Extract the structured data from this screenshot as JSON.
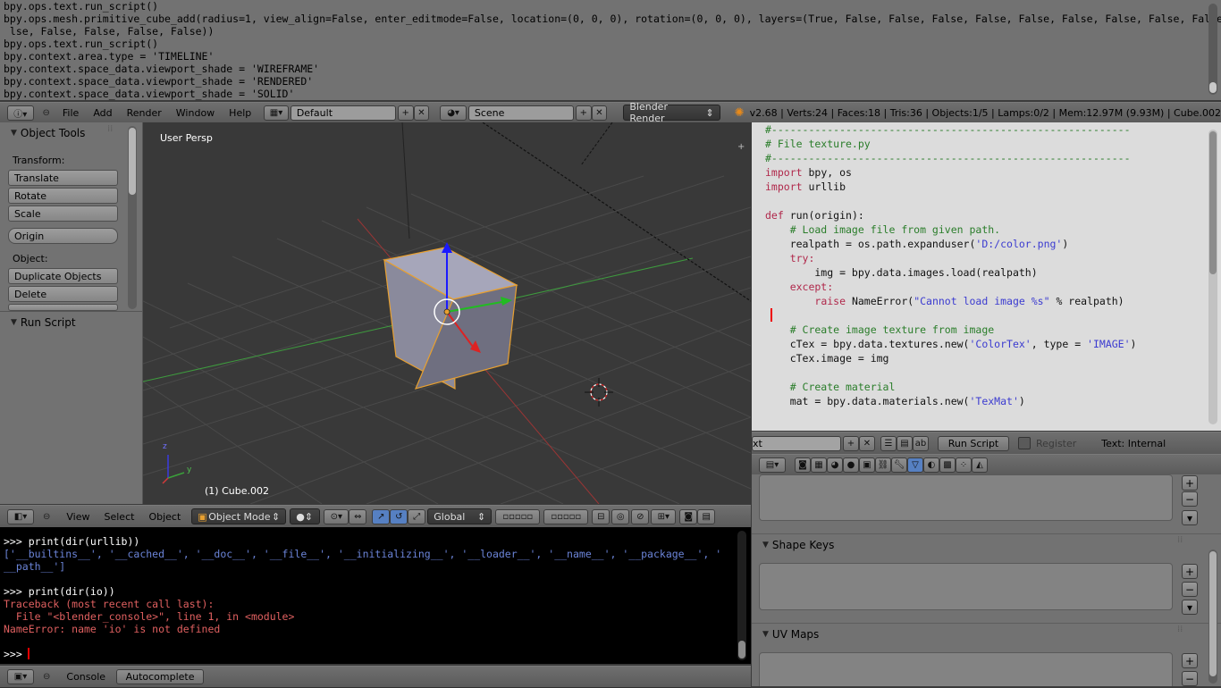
{
  "info_log": {
    "lines": [
      "bpy.ops.text.run_script()",
      "bpy.ops.mesh.primitive_cube_add(radius=1, view_align=False, enter_editmode=False, location=(0, 0, 0), rotation=(0, 0, 0), layers=(True, False, False, False, False, False, False, False, False, False, False, False, False, False, False, False, False, False, False, False))",
      "bpy.ops.text.run_script()",
      "bpy.context.area.type = 'TIMELINE'",
      "bpy.context.space_data.viewport_shade = 'WIREFRAME'",
      "bpy.context.space_data.viewport_shade = 'RENDERED'",
      "bpy.context.space_data.viewport_shade = 'SOLID'"
    ]
  },
  "top_header": {
    "menus": [
      "File",
      "Add",
      "Render",
      "Window",
      "Help"
    ],
    "screen_layout": "Default",
    "scene": "Scene",
    "render_engine": "Blender Render",
    "stats": "v2.68 | Verts:24 | Faces:18 | Tris:36 | Objects:1/5 | Lamps:0/2 | Mem:12.97M (9.93M) | Cube.002"
  },
  "tool_shelf": {
    "title": "Object Tools",
    "transform_label": "Transform:",
    "buttons_transform": [
      "Translate",
      "Rotate",
      "Scale"
    ],
    "origin": "Origin",
    "object_label": "Object:",
    "buttons_object": [
      "Duplicate Objects",
      "Delete"
    ],
    "run_script_panel": "Run Script"
  },
  "viewport": {
    "view_label": "User Persp",
    "object_label": "(1) Cube.002",
    "axis_y": "y",
    "axis_z": "z"
  },
  "viewport_header": {
    "menus": [
      "View",
      "Select",
      "Object"
    ],
    "mode": "Object Mode",
    "orientation": "Global"
  },
  "text_editor": {
    "lines": [
      {
        "t": "#----------------------------------------------------------",
        "c": "com"
      },
      {
        "t": "# File texture.py",
        "c": "com"
      },
      {
        "t": "#----------------------------------------------------------",
        "c": "com"
      },
      {
        "t": "import bpy, os",
        "c": "mix1"
      },
      {
        "t": "import urllib",
        "c": "mix2"
      },
      {
        "t": "",
        "c": "pl"
      },
      {
        "t": "def run(origin):",
        "c": "def"
      },
      {
        "t": "    # Load image file from given path.",
        "c": "com"
      },
      {
        "t": "    realpath = os.path.expanduser('D:/color.png')",
        "c": "str1"
      },
      {
        "t": "    try:",
        "c": "kw"
      },
      {
        "t": "        img = bpy.data.images.load(realpath)",
        "c": "pl"
      },
      {
        "t": "    except:",
        "c": "kw"
      },
      {
        "t": "        raise NameError(\"Cannot load image %s\" % realpath)",
        "c": "str2"
      },
      {
        "t": "",
        "c": "pl"
      },
      {
        "t": "    # Create image texture from image",
        "c": "com"
      },
      {
        "t": "    cTex = bpy.data.textures.new('ColorTex', type = 'IMAGE')",
        "c": "str3"
      },
      {
        "t": "    cTex.image = img",
        "c": "pl"
      },
      {
        "t": "",
        "c": "pl"
      },
      {
        "t": "    # Create material",
        "c": "com"
      },
      {
        "t": "    mat = bpy.data.materials.new('TexMat')",
        "c": "str4"
      }
    ]
  },
  "text_header": {
    "name_field": "xt",
    "run_script": "Run Script",
    "register": "Register",
    "status": "Text: Internal"
  },
  "console": {
    "lines": [
      {
        "t": ">>> print(dir(urllib))",
        "c": "in"
      },
      {
        "t": "['__builtins__', '__cached__', '__doc__', '__file__', '__initializing__', '__loader__', '__name__', '__package__', '",
        "c": "out"
      },
      {
        "t": "__path__']",
        "c": "out"
      },
      {
        "t": "",
        "c": "out"
      },
      {
        "t": ">>> print(dir(io))",
        "c": "in"
      },
      {
        "t": "Traceback (most recent call last):",
        "c": "err"
      },
      {
        "t": "  File \"<blender_console>\", line 1, in <module>",
        "c": "err"
      },
      {
        "t": "NameError: name 'io' is not defined",
        "c": "err"
      },
      {
        "t": "",
        "c": "out"
      },
      {
        "t": ">>> ",
        "c": "in"
      }
    ]
  },
  "console_header": {
    "console": "Console",
    "autocomplete": "Autocomplete"
  },
  "properties": {
    "shape_keys": "Shape Keys",
    "uv_maps": "UV Maps"
  }
}
